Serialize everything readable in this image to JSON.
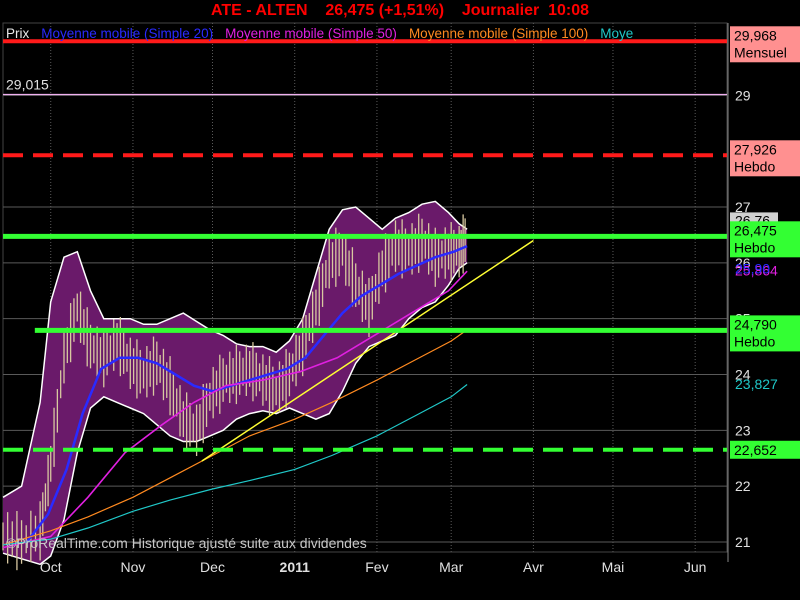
{
  "header": {
    "title": "ATE - ALTEN    26,475 (+1,51%)    Journalier  10:08"
  },
  "legend": [
    {
      "label": "Prix",
      "color": "#e8e8e8"
    },
    {
      "label": "Moyenne mobile (Simple 20)",
      "color": "#2a2aff"
    },
    {
      "label": "Moyenne mobile (Simple 50)",
      "color": "#e020e0"
    },
    {
      "label": "Moyenne mobile (Simple 100)",
      "color": "#ff8a20"
    },
    {
      "label": "Moye",
      "color": "#20c8c8"
    }
  ],
  "watermark": "©ProRealTime.com Historique ajusté suite aux dividendes",
  "colors": {
    "background": "#000000",
    "grid": "#5a5a5a",
    "support_green": "#33ff33",
    "resistance_red": "#ff1a1a",
    "band_fill": "#6a1a6a",
    "band_edge": "#ffffff",
    "trendline": "#ffff33",
    "ma20": "#2a2aff",
    "ma50": "#e020e0",
    "ma100": "#ff8a20",
    "ma200": "#20c8c8",
    "candles": "#d8c8a0"
  },
  "chart_data": {
    "type": "line",
    "title": "ATE - ALTEN    26,475 (+1,51%)    Journalier  10:08",
    "x_axis": {
      "tick_labels": [
        "Oct",
        "Nov",
        "Dec",
        "2011",
        "Fev",
        "Mar",
        "Avr",
        "Mai",
        "Jun"
      ],
      "tick_dates": [
        "2010-10-01",
        "2010-11-01",
        "2010-12-01",
        "2011-01-01",
        "2011-02-01",
        "2011-03-01",
        "2011-04-01",
        "2011-05-01",
        "2011-06-01"
      ],
      "range": [
        "2010-09-13",
        "2011-06-13"
      ]
    },
    "y_axis": {
      "ylim": [
        20.95,
        30.0
      ],
      "tick_labels": [
        "21",
        "22",
        "23",
        "24",
        "25",
        "26",
        "27",
        "29"
      ],
      "tick_values": [
        21,
        22,
        23,
        24,
        25,
        26,
        27,
        29
      ]
    },
    "grid": true,
    "horizontal_levels": [
      {
        "value": 29.968,
        "label": "29,968",
        "sublabel": "Mensuel",
        "style": "solid",
        "color": "#ff1a1a",
        "tag_color": "#ff9090"
      },
      {
        "value": 29.015,
        "label": "29,015",
        "sublabel": "",
        "style": "solid-thin",
        "color": "#f0b0f0",
        "tag_color": ""
      },
      {
        "value": 27.926,
        "label": "27,926",
        "sublabel": "Hebdo",
        "style": "dashed",
        "color": "#ff1a1a",
        "tag_color": "#ff9090"
      },
      {
        "value": 26.475,
        "label": "26,475",
        "sublabel": "Hebdo",
        "style": "solid",
        "color": "#33ff33",
        "tag_color": "#33ff33"
      },
      {
        "value": 24.79,
        "label": "24,790",
        "sublabel": "Hebdo",
        "style": "solid-from",
        "from": "2010-09-25",
        "color": "#33ff33",
        "tag_color": "#33ff33"
      },
      {
        "value": 22.652,
        "label": "22,652",
        "sublabel": "",
        "style": "dashed",
        "color": "#33ff33",
        "tag_color": "#33ff33"
      }
    ],
    "axis_value_tags": [
      {
        "value": 26.76,
        "label": "26,76",
        "color": "#000000",
        "bg": "#d0d0d0"
      },
      {
        "value": 25.864,
        "label": "25,864",
        "color": "#e020e0",
        "bg": "#000000"
      },
      {
        "value": 25.9,
        "label": "25,90",
        "color": "#2a2aff",
        "bg": "#000000"
      },
      {
        "value": 23.827,
        "label": "23,827",
        "color": "#20c8c8",
        "bg": "#000000"
      }
    ],
    "series": [
      {
        "name": "Moyenne mobile (Simple 20)",
        "color": "#2a2aff",
        "x": [
          "2010-09-22",
          "2010-09-30",
          "2010-10-07",
          "2010-10-13",
          "2010-10-20",
          "2010-10-27",
          "2010-11-03",
          "2010-11-10",
          "2010-11-17",
          "2010-11-24",
          "2010-12-01",
          "2010-12-08",
          "2010-12-15",
          "2010-12-22",
          "2010-12-29",
          "2011-01-05",
          "2011-01-12",
          "2011-01-19",
          "2011-01-26",
          "2011-02-02",
          "2011-02-09",
          "2011-02-16",
          "2011-02-23",
          "2011-03-02",
          "2011-03-07"
        ],
        "y": [
          21.0,
          21.5,
          22.3,
          23.3,
          24.1,
          24.3,
          24.3,
          24.2,
          24.0,
          23.8,
          23.7,
          23.8,
          23.9,
          24.0,
          24.1,
          24.3,
          24.7,
          25.1,
          25.4,
          25.6,
          25.8,
          25.95,
          26.1,
          26.2,
          26.3
        ]
      },
      {
        "name": "Moyenne mobile (Simple 50)",
        "color": "#e020e0",
        "x": [
          "2010-09-13",
          "2010-10-01",
          "2010-10-15",
          "2010-10-29",
          "2010-11-12",
          "2010-11-24",
          "2010-12-06",
          "2010-12-20",
          "2011-01-03",
          "2011-01-17",
          "2011-01-31",
          "2011-02-14",
          "2011-02-28",
          "2011-03-07"
        ],
        "y": [
          20.9,
          21.1,
          21.8,
          22.6,
          23.1,
          23.5,
          23.8,
          23.9,
          24.05,
          24.3,
          24.7,
          25.1,
          25.5,
          25.85
        ]
      },
      {
        "name": "Moyenne mobile (Simple 100)",
        "color": "#ff8a20",
        "x": [
          "2010-09-13",
          "2010-10-01",
          "2010-10-15",
          "2010-11-01",
          "2010-11-15",
          "2010-12-01",
          "2010-12-15",
          "2011-01-01",
          "2011-01-15",
          "2011-02-01",
          "2011-02-15",
          "2011-03-01",
          "2011-03-07"
        ],
        "y": [
          20.95,
          21.2,
          21.45,
          21.8,
          22.15,
          22.55,
          22.9,
          23.2,
          23.5,
          23.9,
          24.25,
          24.6,
          24.8
        ]
      },
      {
        "name": "Moye",
        "color": "#20c8c8",
        "x": [
          "2010-09-13",
          "2010-10-01",
          "2010-10-15",
          "2010-11-01",
          "2010-11-15",
          "2010-12-01",
          "2010-12-15",
          "2011-01-01",
          "2011-01-15",
          "2011-02-01",
          "2011-02-15",
          "2011-03-01",
          "2011-03-07"
        ],
        "y": [
          20.95,
          21.05,
          21.25,
          21.55,
          21.75,
          21.95,
          22.1,
          22.3,
          22.55,
          22.9,
          23.25,
          23.6,
          23.82
        ]
      }
    ],
    "bollinger": {
      "x": [
        "2010-09-13",
        "2010-09-20",
        "2010-09-27",
        "2010-10-01",
        "2010-10-06",
        "2010-10-11",
        "2010-10-16",
        "2010-10-21",
        "2010-10-26",
        "2010-10-31",
        "2010-11-05",
        "2010-11-10",
        "2010-11-15",
        "2010-11-20",
        "2010-11-25",
        "2010-11-30",
        "2010-12-05",
        "2010-12-10",
        "2010-12-15",
        "2010-12-20",
        "2010-12-25",
        "2010-12-30",
        "2011-01-04",
        "2011-01-09",
        "2011-01-14",
        "2011-01-19",
        "2011-01-24",
        "2011-01-29",
        "2011-02-03",
        "2011-02-08",
        "2011-02-13",
        "2011-02-18",
        "2011-02-23",
        "2011-02-28",
        "2011-03-04",
        "2011-03-07"
      ],
      "upper": [
        21.8,
        22.0,
        23.5,
        25.3,
        26.1,
        26.2,
        25.5,
        25.0,
        25.0,
        25.0,
        24.9,
        24.9,
        25.0,
        25.1,
        24.95,
        24.8,
        24.7,
        24.55,
        24.5,
        24.5,
        24.4,
        24.6,
        25.0,
        25.8,
        26.6,
        26.95,
        27.0,
        26.8,
        26.6,
        26.8,
        26.9,
        27.05,
        27.1,
        26.9,
        26.7,
        26.6
      ],
      "lower": [
        20.8,
        20.7,
        20.6,
        20.75,
        21.4,
        22.6,
        23.4,
        23.6,
        23.5,
        23.4,
        23.3,
        23.1,
        22.9,
        22.8,
        22.8,
        22.9,
        23.0,
        23.2,
        23.3,
        23.35,
        23.3,
        23.4,
        23.3,
        23.2,
        23.3,
        23.7,
        24.2,
        24.5,
        24.6,
        24.7,
        25.0,
        25.2,
        25.3,
        25.6,
        25.9,
        26.0
      ]
    },
    "trendlines": [
      {
        "from": {
          "x": "2010-11-27",
          "y": 22.45
        },
        "to": {
          "x": "2011-04-01",
          "y": 26.4
        },
        "color": "#ffff33"
      }
    ],
    "price": {
      "x": [
        "2010-09-13",
        "2010-09-20",
        "2010-09-27",
        "2010-10-01",
        "2010-10-06",
        "2010-10-11",
        "2010-10-16",
        "2010-10-21",
        "2010-10-26",
        "2010-10-31",
        "2010-11-05",
        "2010-11-10",
        "2010-11-15",
        "2010-11-20",
        "2010-11-25",
        "2010-11-30",
        "2010-12-05",
        "2010-12-10",
        "2010-12-15",
        "2010-12-20",
        "2010-12-25",
        "2010-12-30",
        "2011-01-04",
        "2011-01-09",
        "2011-01-14",
        "2011-01-19",
        "2011-01-24",
        "2011-01-29",
        "2011-02-03",
        "2011-02-08",
        "2011-02-13",
        "2011-02-18",
        "2011-02-23",
        "2011-02-28",
        "2011-03-04",
        "2011-03-07"
      ],
      "close": [
        21.1,
        21.0,
        21.2,
        22.4,
        24.3,
        25.2,
        24.5,
        24.3,
        24.6,
        24.2,
        24.0,
        24.2,
        23.8,
        23.2,
        23.0,
        23.6,
        23.9,
        24.0,
        24.1,
        23.9,
        23.7,
        24.0,
        24.5,
        25.2,
        26.0,
        26.2,
        25.6,
        25.2,
        25.9,
        26.3,
        26.2,
        26.4,
        26.1,
        26.2,
        26.2,
        26.475
      ]
    },
    "watermark": "©ProRealTime.com Historique ajusté suite aux dividendes"
  }
}
